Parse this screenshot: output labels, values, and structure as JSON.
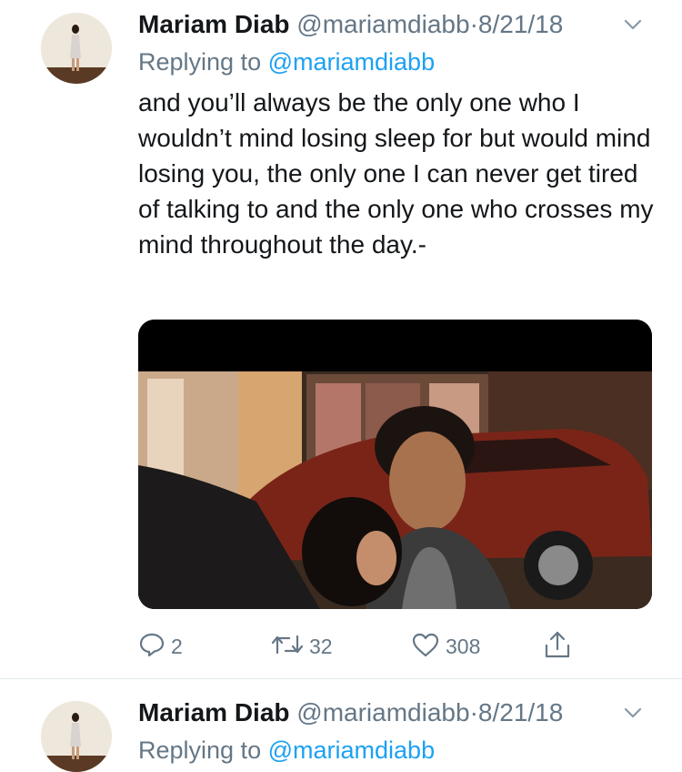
{
  "tweets": [
    {
      "author_name": "Mariam Diab",
      "handle": "@mariamdiabb",
      "separator": "·",
      "date": "8/21/18",
      "replying_prefix": "Replying to",
      "replying_to": "@mariamdiabb",
      "text": "and you’ll always be the only one who I wouldn’t mind losing sleep for but would mind losing you, the only one I can never get tired of talking to and the only one who crosses my mind throughout the day.-",
      "stats": {
        "replies": "2",
        "retweets": "32",
        "likes": "308"
      }
    },
    {
      "author_name": "Mariam Diab",
      "handle": "@mariamdiabb",
      "separator": "·",
      "date": "8/21/18",
      "replying_prefix": "Replying to",
      "replying_to": "@mariamdiabb"
    }
  ],
  "icons": {
    "caret": "chevron-down-icon",
    "reply": "reply-icon",
    "retweet": "retweet-icon",
    "like": "heart-icon",
    "share": "share-icon"
  },
  "colors": {
    "text_primary": "#14171a",
    "text_secondary": "#657786",
    "link": "#1da1f2",
    "divider": "#e1e8ed"
  }
}
